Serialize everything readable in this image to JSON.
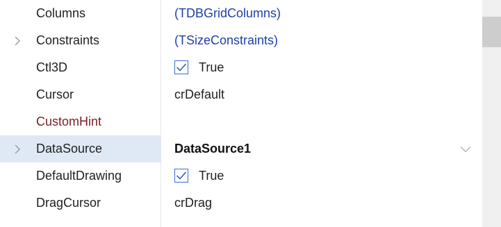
{
  "properties": [
    {
      "name": "Columns",
      "value": "(TDBGridColumns)"
    },
    {
      "name": "Constraints",
      "value": "(TSizeConstraints)"
    },
    {
      "name": "Ctl3D",
      "value": "True"
    },
    {
      "name": "Cursor",
      "value": "crDefault"
    },
    {
      "name": "CustomHint",
      "value": ""
    },
    {
      "name": "DataSource",
      "value": "DataSource1"
    },
    {
      "name": "DefaultDrawing",
      "value": "True"
    },
    {
      "name": "DragCursor",
      "value": "crDrag"
    }
  ],
  "colors": {
    "reference_value": "#1f3fa8",
    "event_name": "#7a1f1f",
    "selected_row": "#dfe9f5",
    "checkbox_border": "#3a6fd1"
  }
}
